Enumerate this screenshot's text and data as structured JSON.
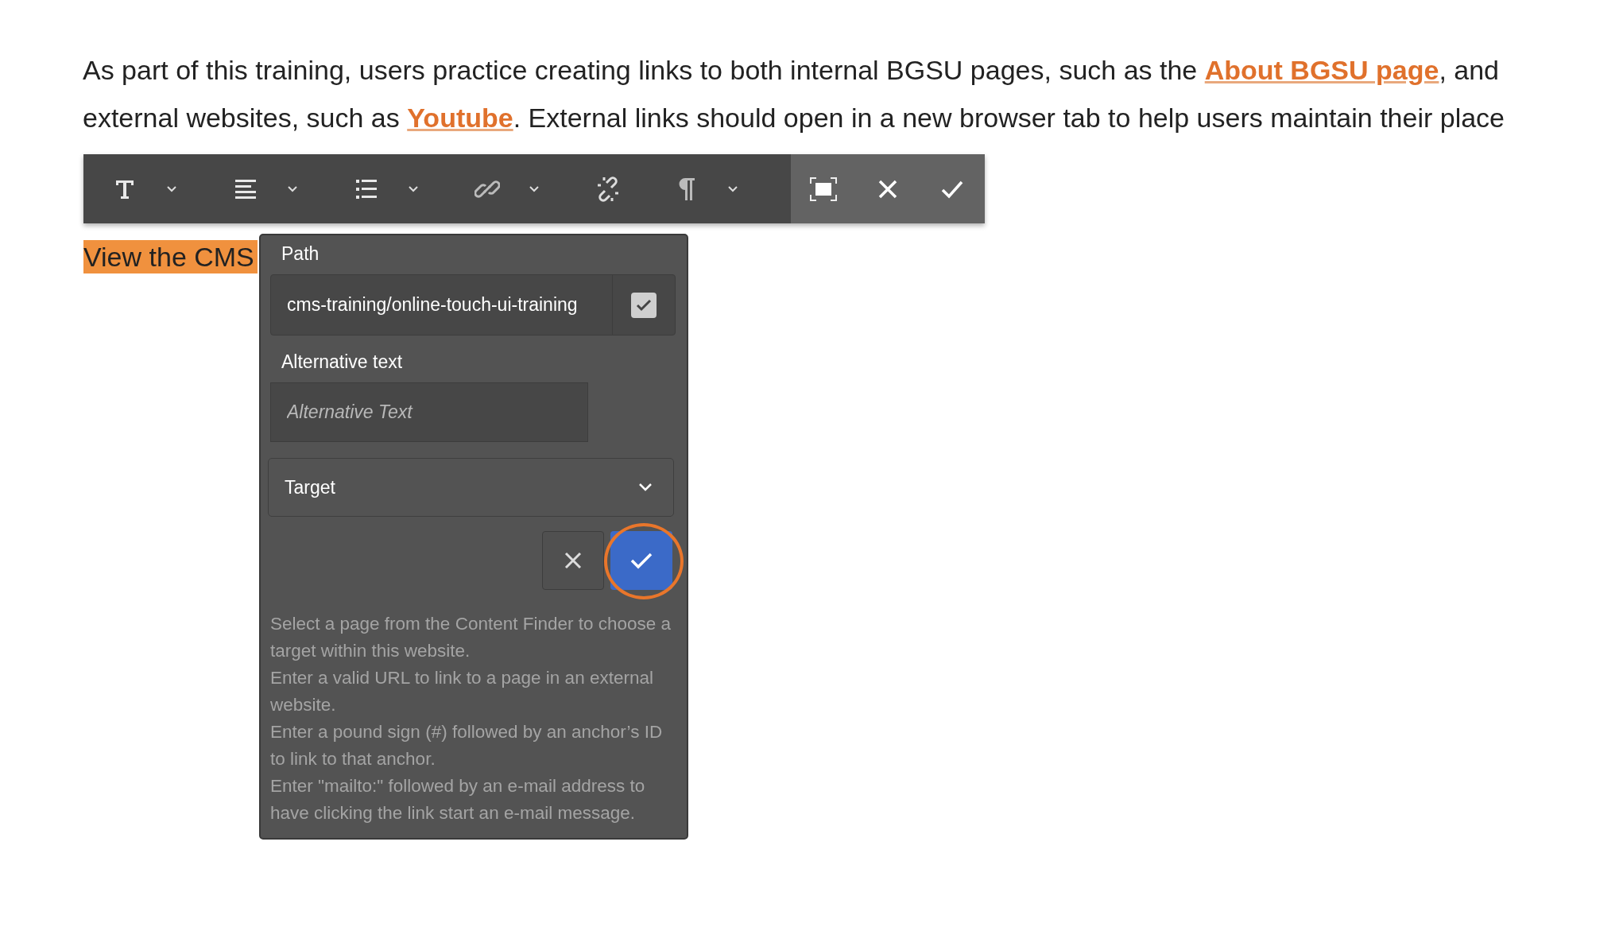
{
  "paragraph": [
    {
      "kind": "text",
      "text": "As part of this training, users practice creating links to both internal BGSU pages, such as the "
    },
    {
      "kind": "link",
      "text": "About BGSU page"
    },
    {
      "kind": "text",
      "text": ", and external websites, such as "
    },
    {
      "kind": "link",
      "text": "Youtube"
    },
    {
      "kind": "text",
      "text": ". External links should open in a new browser tab to help users maintain their place"
    }
  ],
  "highlighted_text": "View the CMS",
  "link_dialog": {
    "path_label": "Path",
    "path_value": "cms-training/online-touch-ui-training",
    "path_checked": true,
    "alt_label": "Alternative text",
    "alt_placeholder": "Alternative Text",
    "target_placeholder": "Target",
    "confirm_highlighted": true,
    "help": [
      "Select a page from the Content Finder to choose a target within this website.",
      "Enter a valid URL to link to a page in an external website.",
      "Enter a pound sign (#) followed by an anchor’s ID to link to that anchor.",
      "Enter \"mailto:\" followed by an e-mail address to have clicking the link start an e-mail message."
    ]
  }
}
